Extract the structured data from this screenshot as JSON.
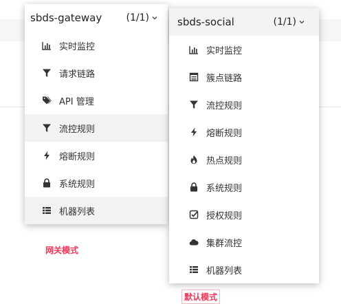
{
  "gateway_menu": {
    "title": "sbds-gateway",
    "count": "(1/1)",
    "items": [
      {
        "label": "实时监控",
        "icon": "bar-chart-icon"
      },
      {
        "label": "请求链路",
        "icon": "filter-icon"
      },
      {
        "label": "API 管理",
        "icon": "tags-icon"
      },
      {
        "label": "流控规则",
        "icon": "filter-icon"
      },
      {
        "label": "熔断规则",
        "icon": "bolt-icon"
      },
      {
        "label": "系统规则",
        "icon": "lock-icon"
      },
      {
        "label": "机器列表",
        "icon": "list-icon"
      }
    ]
  },
  "social_menu": {
    "title": "sbds-social",
    "count": "(1/1)",
    "items": [
      {
        "label": "实时监控",
        "icon": "bar-chart-icon"
      },
      {
        "label": "簇点链路",
        "icon": "table-icon"
      },
      {
        "label": "流控规则",
        "icon": "filter-icon"
      },
      {
        "label": "熔断规则",
        "icon": "bolt-icon"
      },
      {
        "label": "热点规则",
        "icon": "fire-icon"
      },
      {
        "label": "系统规则",
        "icon": "lock-icon"
      },
      {
        "label": "授权规则",
        "icon": "check-square-icon"
      },
      {
        "label": "集群流控",
        "icon": "cloud-icon"
      },
      {
        "label": "机器列表",
        "icon": "list-icon"
      }
    ]
  },
  "labels": {
    "gateway_mode": "网关模式",
    "default_mode": "默认模式"
  },
  "colors": {
    "label_red": "#ff3355",
    "hover_bg": "#f2f2f2"
  }
}
